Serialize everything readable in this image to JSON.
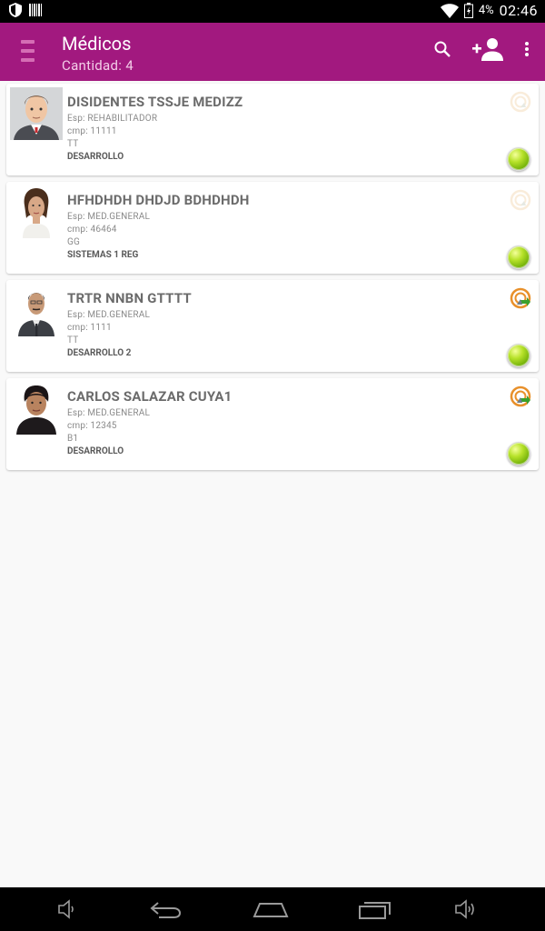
{
  "status_bar": {
    "battery_pct": "4%",
    "time": "02:46"
  },
  "app_bar": {
    "title": "Médicos",
    "subtitle": "Cantidad: 4"
  },
  "colors": {
    "app_bar": "#a2197f",
    "status_ok": "#7fc416"
  },
  "doctors": [
    {
      "name": "DISIDENTES TSSJE MEDIZZ",
      "specialty": "Esp: REHABILITADOR",
      "cmp": "cmp: 11111",
      "code": "TT",
      "department": "DESARROLLO",
      "sync_state": "faded",
      "status": "green"
    },
    {
      "name": "HFHDHDH DHDJD BDHDHDH",
      "specialty": "Esp: MED.GENERAL",
      "cmp": "cmp: 46464",
      "code": "GG",
      "department": "SISTEMAS 1 REG",
      "sync_state": "faded",
      "status": "green"
    },
    {
      "name": "TRTR NNBN GTTTT",
      "specialty": "Esp: MED.GENERAL",
      "cmp": "cmp: 1111",
      "code": "TT",
      "department": "DESARROLLO 2",
      "sync_state": "active",
      "status": "green"
    },
    {
      "name": "CARLOS SALAZAR CUYA1",
      "specialty": "Esp: MED.GENERAL",
      "cmp": "cmp: 12345",
      "code": "B1",
      "department": "DESARROLLO",
      "sync_state": "active",
      "status": "green"
    }
  ]
}
